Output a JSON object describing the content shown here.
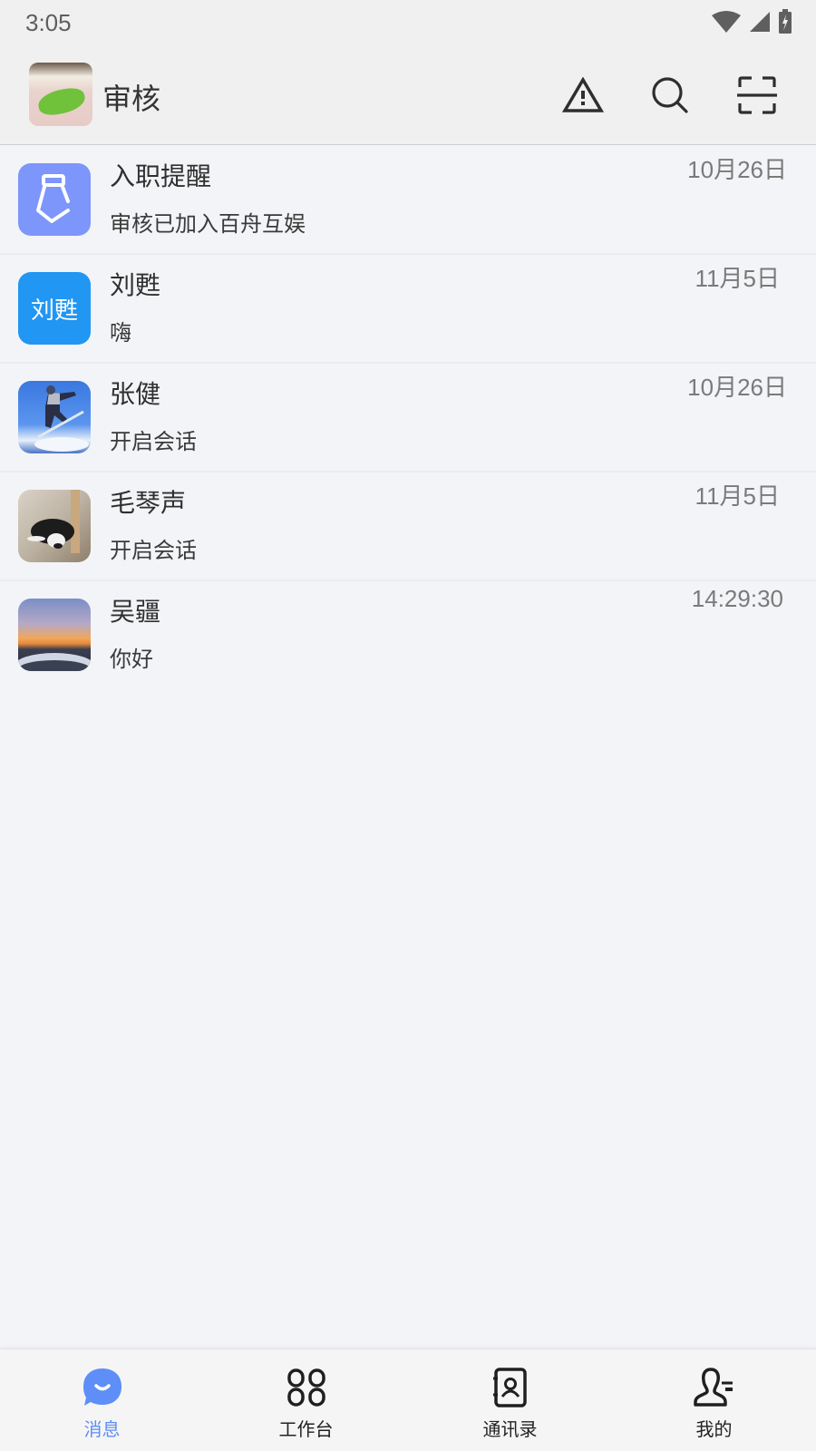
{
  "status_bar": {
    "time": "3:05",
    "icons": [
      "wifi-icon",
      "cellular-signal-icon",
      "battery-charging-icon"
    ]
  },
  "header": {
    "title": "审核",
    "avatar": "kermit-frog-photo",
    "actions": [
      {
        "name": "warning-icon"
      },
      {
        "name": "search-icon"
      },
      {
        "name": "scan-icon"
      }
    ]
  },
  "conversations": [
    {
      "name": "入职提醒",
      "message": "审核已加入百舟互娱",
      "time": "10月26日",
      "avatar": "necktie-icon",
      "avatar_color": "#7d96fb"
    },
    {
      "name": "刘甦",
      "message": "嗨",
      "time": "11月5日",
      "avatar_text": "刘甦",
      "avatar_color": "#2196f3"
    },
    {
      "name": "张健",
      "message": "开启会话",
      "time": "10月26日",
      "avatar": "snowboarder-photo"
    },
    {
      "name": "毛琴声",
      "message": "开启会话",
      "time": "11月5日",
      "avatar": "dog-photo"
    },
    {
      "name": "吴疆",
      "message": "你好",
      "time": "14:29:30",
      "avatar": "sunset-photo"
    }
  ],
  "tabbar": {
    "active_color": "#5e8ef7",
    "tabs": [
      {
        "label": "消息",
        "icon": "chat-bubble-icon",
        "active": true
      },
      {
        "label": "工作台",
        "icon": "grid-apps-icon",
        "active": false
      },
      {
        "label": "通讯录",
        "icon": "contacts-book-icon",
        "active": false
      },
      {
        "label": "我的",
        "icon": "profile-icon",
        "active": false
      }
    ]
  }
}
